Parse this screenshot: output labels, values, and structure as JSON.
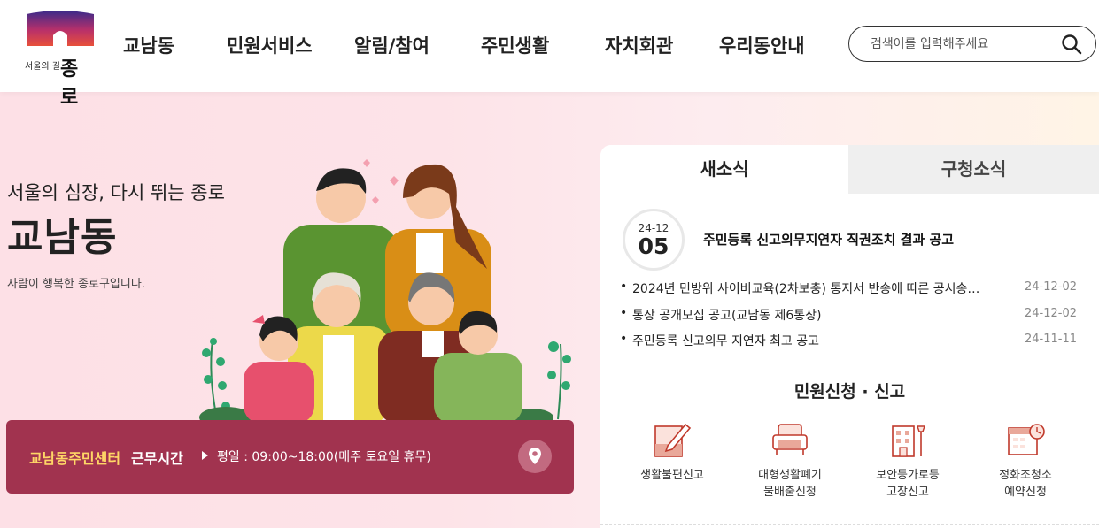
{
  "header": {
    "logo_sub": "서울의 길",
    "logo_main": "종로",
    "nav": [
      "교남동",
      "민원서비스",
      "알림/참여",
      "주민생활",
      "자치회관",
      "우리동안내"
    ],
    "search_placeholder": "검색어를 입력해주세요"
  },
  "hero": {
    "tagline": "서울의 심장, 다시 뛰는 종로",
    "title": "교남동",
    "description": "사람이 행복한 종로구입니다."
  },
  "hours": {
    "center_name": "교남동주민센터",
    "label": "근무시간",
    "time": "평일 : 09:00~18:00(매주 토요일 휴무)"
  },
  "news": {
    "tabs": [
      "새소식",
      "구청소식"
    ],
    "active_tab": "새소식",
    "featured": {
      "month_day": "24-12",
      "day": "05",
      "title": "주민등록 신고의무지연자 직권조치 결과 공고"
    },
    "items": [
      {
        "title": "2024년 민방위 사이버교육(2차보충) 통지서 반송에 따른 공시송…",
        "date": "24-12-02"
      },
      {
        "title": "통장 공개모집 공고(교남동 제6통장)",
        "date": "24-12-02"
      },
      {
        "title": "주민등록 신고의무 지연자 최고 공고",
        "date": "24-11-11"
      }
    ]
  },
  "services": {
    "title": "민원신청 · 신고",
    "items": [
      {
        "line1": "생활불편신고",
        "line2": "",
        "icon": "pencil-note-icon"
      },
      {
        "line1": "대형생활폐기",
        "line2": "물배출신청",
        "icon": "sofa-icon"
      },
      {
        "line1": "보안등가로등",
        "line2": "고장신고",
        "icon": "building-streetlight-icon"
      },
      {
        "line1": "정화조청소",
        "line2": "예약신청",
        "icon": "calendar-clock-icon"
      }
    ]
  },
  "colors": {
    "accent": "#a1334f",
    "highlight": "#ffd766",
    "icon": "#c0392b"
  }
}
